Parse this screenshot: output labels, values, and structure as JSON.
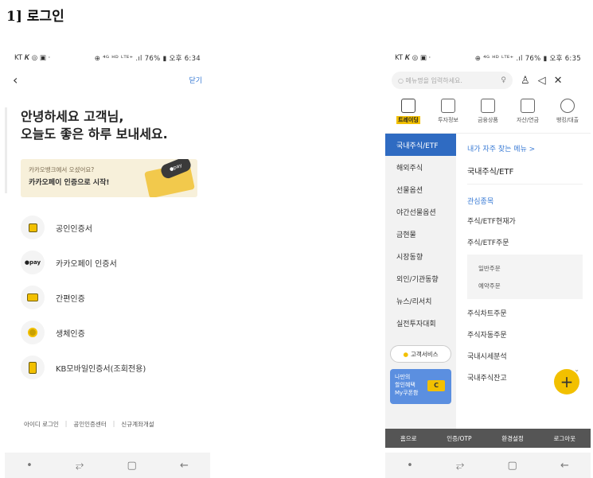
{
  "doc_heading": "1] 로그인",
  "left_phone": {
    "status": {
      "left": "KT 𝑲 ◎ ▣ ·",
      "right": "⊕ ⁴ᴳ ᴴᴰ ᴸᵀᴱ⁺ .ıl 76% ▮ 오후 6:34"
    },
    "close_label": "닫기",
    "greeting_line1": "안녕하세요 고객님,",
    "greeting_line2": "오늘도 좋은 하루 보내세요.",
    "promo": {
      "small": "카카오뱅크에서 오셨어요?",
      "big": "카카오페이 인증으로 시작!",
      "tag": "●pay"
    },
    "auth_items": [
      {
        "label": "공인인증서",
        "icon": "lock-icon"
      },
      {
        "label": "카카오페이 인증서",
        "icon": "kakaopay-icon",
        "icon_text": "●pay"
      },
      {
        "label": "간편인증",
        "icon": "simple-auth-icon"
      },
      {
        "label": "생체인증",
        "icon": "biometric-icon"
      },
      {
        "label": "KB모바일인증서(조회전용)",
        "icon": "mobile-cert-icon"
      }
    ],
    "bottom_links": [
      "아이디 로그인",
      "공인인증센터",
      "신규계좌개설"
    ],
    "separator": "|"
  },
  "right_phone": {
    "status": {
      "left": "KT 𝑲 ◎ ▣ ·",
      "right": "⊕ ⁴ᴳ ᴴᴰ ᴸᵀᴱ⁺ .ıl 76% ▮ 오후 6:35"
    },
    "search_placeholder": "메뉴명을 입력하세요.",
    "quick_menu": [
      "트레이딩",
      "투자정보",
      "금융상품",
      "자산/연금",
      "뱅킹/대출"
    ],
    "left_menu": [
      "국내주식/ETF",
      "해외주식",
      "선물옵션",
      "야간선물옵션",
      "금현물",
      "시장동향",
      "외인/기관동향",
      "뉴스/리서치",
      "실전투자대회"
    ],
    "customer_service": "고객서비스",
    "coupon": {
      "line1": "나만의",
      "line2": "할인혜택",
      "line3": "My쿠폰함",
      "badge": "C"
    },
    "right_menu": {
      "favorites_link": "내가 자주 찾는 메뉴 >",
      "favorite_title": "국내주식/ETF",
      "section": "관심종목",
      "items_top": [
        "주식/ETF현재가",
        "주식/ETF주문"
      ],
      "sub_items": [
        "일반주문",
        "예약주문"
      ],
      "items_bottom": [
        "주식차트주문",
        "주식자동주문",
        "국내시세분석",
        "국내주식잔고"
      ]
    },
    "bottom_bar": [
      "홈으로",
      "인증/OTP",
      "환경설정",
      "로그아웃"
    ]
  },
  "android_nav": [
    "•",
    "⥂",
    "▢",
    "←"
  ],
  "colors": {
    "accent_yellow": "#f2c000",
    "active_blue": "#2f6bc2",
    "link_blue": "#3a7bd5"
  }
}
